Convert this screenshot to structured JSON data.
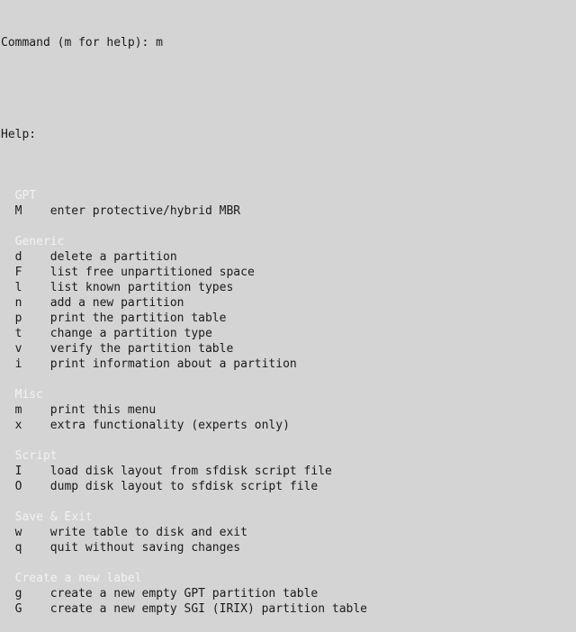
{
  "terminal": {
    "background_color": "#d4d4d4",
    "text_color": "#1a1a1a",
    "section_header_color": "#f2f2f2",
    "prompt_line": "Command (m for help): m",
    "prompt_text": "Command (m for help): ",
    "typed_command": "m",
    "help_label": "Help:"
  },
  "sections": [
    {
      "title": "GPT",
      "commands": [
        {
          "key": "M",
          "description": "enter protective/hybrid MBR"
        }
      ]
    },
    {
      "title": "Generic",
      "commands": [
        {
          "key": "d",
          "description": "delete a partition"
        },
        {
          "key": "F",
          "description": "list free unpartitioned space"
        },
        {
          "key": "l",
          "description": "list known partition types"
        },
        {
          "key": "n",
          "description": "add a new partition"
        },
        {
          "key": "p",
          "description": "print the partition table"
        },
        {
          "key": "t",
          "description": "change a partition type"
        },
        {
          "key": "v",
          "description": "verify the partition table"
        },
        {
          "key": "i",
          "description": "print information about a partition"
        }
      ]
    },
    {
      "title": "Misc",
      "commands": [
        {
          "key": "m",
          "description": "print this menu"
        },
        {
          "key": "x",
          "description": "extra functionality (experts only)"
        }
      ]
    },
    {
      "title": "Script",
      "commands": [
        {
          "key": "I",
          "description": "load disk layout from sfdisk script file"
        },
        {
          "key": "O",
          "description": "dump disk layout to sfdisk script file"
        }
      ]
    },
    {
      "title": "Save & Exit",
      "commands": [
        {
          "key": "w",
          "description": "write table to disk and exit"
        },
        {
          "key": "q",
          "description": "quit without saving changes"
        }
      ]
    },
    {
      "title": "Create a new label",
      "commands": [
        {
          "key": "g",
          "description": "create a new empty GPT partition table"
        },
        {
          "key": "G",
          "description": "create a new empty SGI (IRIX) partition table"
        }
      ]
    }
  ]
}
